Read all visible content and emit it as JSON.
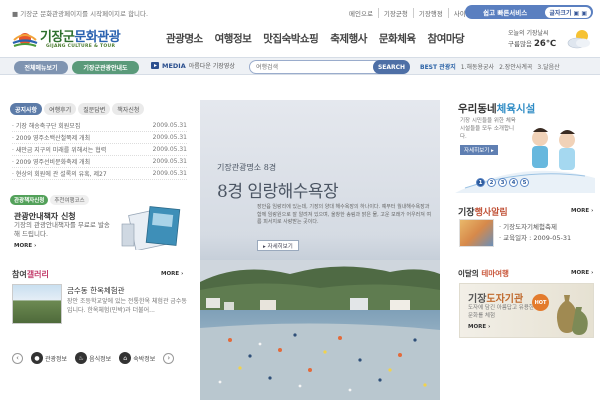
{
  "top": {
    "notice": "기장군 문화관광페이지를 시작페이지로 합니다.",
    "utility": [
      "메인으로",
      "기장군청",
      "기장행정",
      "사이트맵"
    ],
    "pill_main": "쉽고 빠른서비스",
    "pill_aux": "글자크기 ▣ ▣"
  },
  "logo": {
    "title_green": "기장군",
    "title_blue": "문화관광",
    "sub": "GIJANG CULTURE & TOUR"
  },
  "nav": [
    "관광명소",
    "여행정보",
    "맛집숙박쇼핑",
    "축제행사",
    "문화체육",
    "참여마당"
  ],
  "weather": {
    "label": "오늘의 기장날씨",
    "condition": "구름많음",
    "temp": "26℃"
  },
  "toolbar": {
    "all_menu": "전체메뉴보기",
    "guide": "기장군관광안내도",
    "media_label": "MEDIA",
    "media_text": "아름다운 기장영상",
    "search_placeholder": "여행검색",
    "search_button": "SEARCH",
    "best_label": "BEST 관광지",
    "best_items": [
      "1.해동용궁사",
      "2.장안사계곡",
      "3.달음산"
    ]
  },
  "notice_tabs": [
    "공지사항",
    "여행후기",
    "질문답변",
    "책자신청"
  ],
  "notices": [
    {
      "title": "· 기장 해송축구단 회원모집",
      "date": "2009.05.31"
    },
    {
      "title": "· 2009 영주소백산철쭉제 개최",
      "date": "2009.05.31"
    },
    {
      "title": "· 새만금 지구의 미래를 위해서는 협력",
      "date": "2009.05.31"
    },
    {
      "title": "· 2009 영주선비문화축제 개최",
      "date": "2009.05.31"
    },
    {
      "title": "· 현상의 회원에 관 설록의 유혹, 제27",
      "date": "2009.05.31"
    }
  ],
  "info_tabs": [
    "관광책자신청",
    "추천여행코스"
  ],
  "info": {
    "title": "관광안내책자 신청",
    "desc": "기장의 관광안내책자를 무료로 발송해 드립니다.",
    "more": "MORE"
  },
  "gallery": {
    "head_a": "참여",
    "head_b": "갤러리",
    "more": "MORE",
    "title": "금수동 한옥체험관",
    "desc": "장안 조등학교앞에 있는 전통한옥 체험관 금수동 입니다. 한옥체험(민박)과 더불어..."
  },
  "bottom": {
    "items": [
      "관광정보",
      "음식정보",
      "숙박정보"
    ],
    "prev": "‹",
    "next": "›"
  },
  "feature": {
    "subtitle": "기장관광명소 8경",
    "title": "8경 임랑해수욕장",
    "desc": "장안읍 임랑리에 있는데, 기장의 양대 해수욕장의 하나이다. 예부터 월내해수욕장과 함께 임랑원으로 잘 알려져 있으며, 울창한 송림과 맑은 물, 고운 모래가 어우러져 여름 피서지로 사랑받는 곳이다.",
    "button": "▸ 자세히보기"
  },
  "right": {
    "village_head_a": "우리동네",
    "village_head_b": "체육시설",
    "village_desc": "기장 시민들을 위한 체육시설들을 모두 소개합니다.",
    "village_button": "자세히보기 ▸",
    "dots": [
      "1",
      "2",
      "3",
      "4",
      "5"
    ],
    "event_head_a": "기장",
    "event_head_b": "행사알림",
    "event_more": "MORE",
    "event_line1": "· 기장도자기체험축제",
    "event_line2": "· 교육일자 : 2009-05-31",
    "theme_head_a": "이달의 ",
    "theme_head_b": "테마여행",
    "theme_more": "MORE",
    "theme_title_a": "기장",
    "theme_title_b": "도자기관",
    "theme_desc": "도자에 담긴 아름답고 유용한 문화를 체험",
    "theme_box_more": "MORE",
    "hot": "HOT"
  },
  "colors": {
    "accent_blue": "#5a7fc0",
    "accent_green": "#53a15a",
    "toolbar_bg": "#eef1f5"
  }
}
